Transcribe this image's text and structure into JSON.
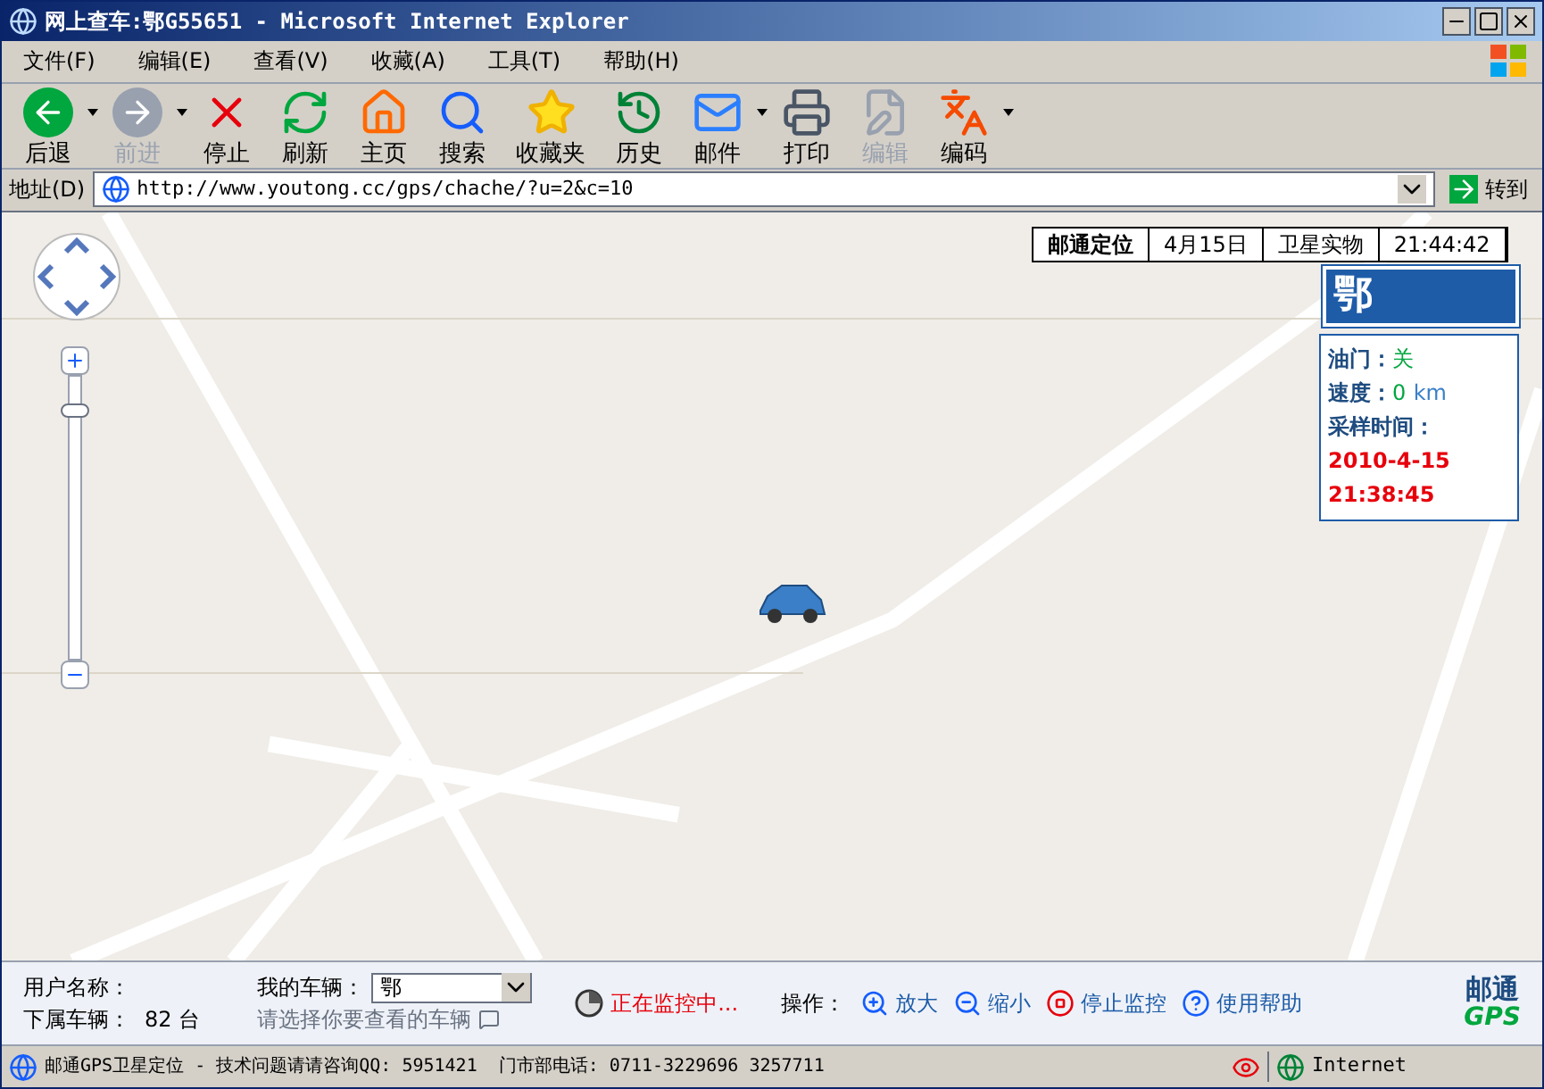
{
  "window": {
    "title": "网上查车:鄂G55651 - Microsoft Internet Explorer"
  },
  "menu": [
    "文件(F)",
    "编辑(E)",
    "查看(V)",
    "收藏(A)",
    "工具(T)",
    "帮助(H)"
  ],
  "toolbar": [
    {
      "kind": "back",
      "label": "后退",
      "disabled": false,
      "dropdown": true
    },
    {
      "kind": "forward",
      "label": "前进",
      "disabled": true,
      "dropdown": true
    },
    {
      "kind": "stop",
      "label": "停止",
      "disabled": false,
      "dropdown": false
    },
    {
      "kind": "refresh",
      "label": "刷新",
      "disabled": false,
      "dropdown": false
    },
    {
      "kind": "home",
      "label": "主页",
      "disabled": false,
      "dropdown": false
    },
    {
      "kind": "search",
      "label": "搜索",
      "disabled": false,
      "dropdown": false
    },
    {
      "kind": "favorites",
      "label": "收藏夹",
      "disabled": false,
      "dropdown": false
    },
    {
      "kind": "history",
      "label": "历史",
      "disabled": false,
      "dropdown": false
    },
    {
      "kind": "mail",
      "label": "邮件",
      "disabled": false,
      "dropdown": true
    },
    {
      "kind": "print",
      "label": "打印",
      "disabled": false,
      "dropdown": false
    },
    {
      "kind": "edit",
      "label": "编辑",
      "disabled": true,
      "dropdown": false
    },
    {
      "kind": "encoding",
      "label": "编码",
      "disabled": false,
      "dropdown": true
    }
  ],
  "address": {
    "label": "地址(D)",
    "value": "http://www.youtong.cc/gps/chache/?u=2&c=10",
    "go": "转到"
  },
  "map": {
    "zoom_slider": {
      "level": 0.9
    },
    "status_strip": [
      "邮通定位",
      "4月15日",
      "卫星实物",
      "21:44:42"
    ],
    "plate": "鄂",
    "info": {
      "throttle_label": "油门：",
      "throttle": "关",
      "speed_label": "速度：",
      "speed": "0",
      "speed_unit": "km",
      "time_label": "采样时间：",
      "date": "2010-4-15",
      "time": "21:38:45"
    }
  },
  "panel": {
    "user_label": "用户名称：",
    "vehicles_label": "下属车辆：",
    "vehicles_count": "82 台",
    "my_vehicle_label": "我的车辆：",
    "my_vehicle_value": "鄂",
    "hint": "请选择你要查看的车辆",
    "monitor": "正在监控中...",
    "ops_label": "操作：",
    "ops": [
      {
        "kind": "zoom_in",
        "label": "放大"
      },
      {
        "kind": "zoom_out",
        "label": "缩小"
      },
      {
        "kind": "stop",
        "label": "停止监控"
      },
      {
        "kind": "help",
        "label": "使用帮助"
      }
    ],
    "logo": {
      "name": "邮通",
      "sub": "GPS"
    }
  },
  "status_bar": {
    "text": "邮通GPS卫星定位 - 技术问题请请咨询QQ: 5951421  门市部电话: 0711-3229696 3257711",
    "zone": "Internet"
  }
}
